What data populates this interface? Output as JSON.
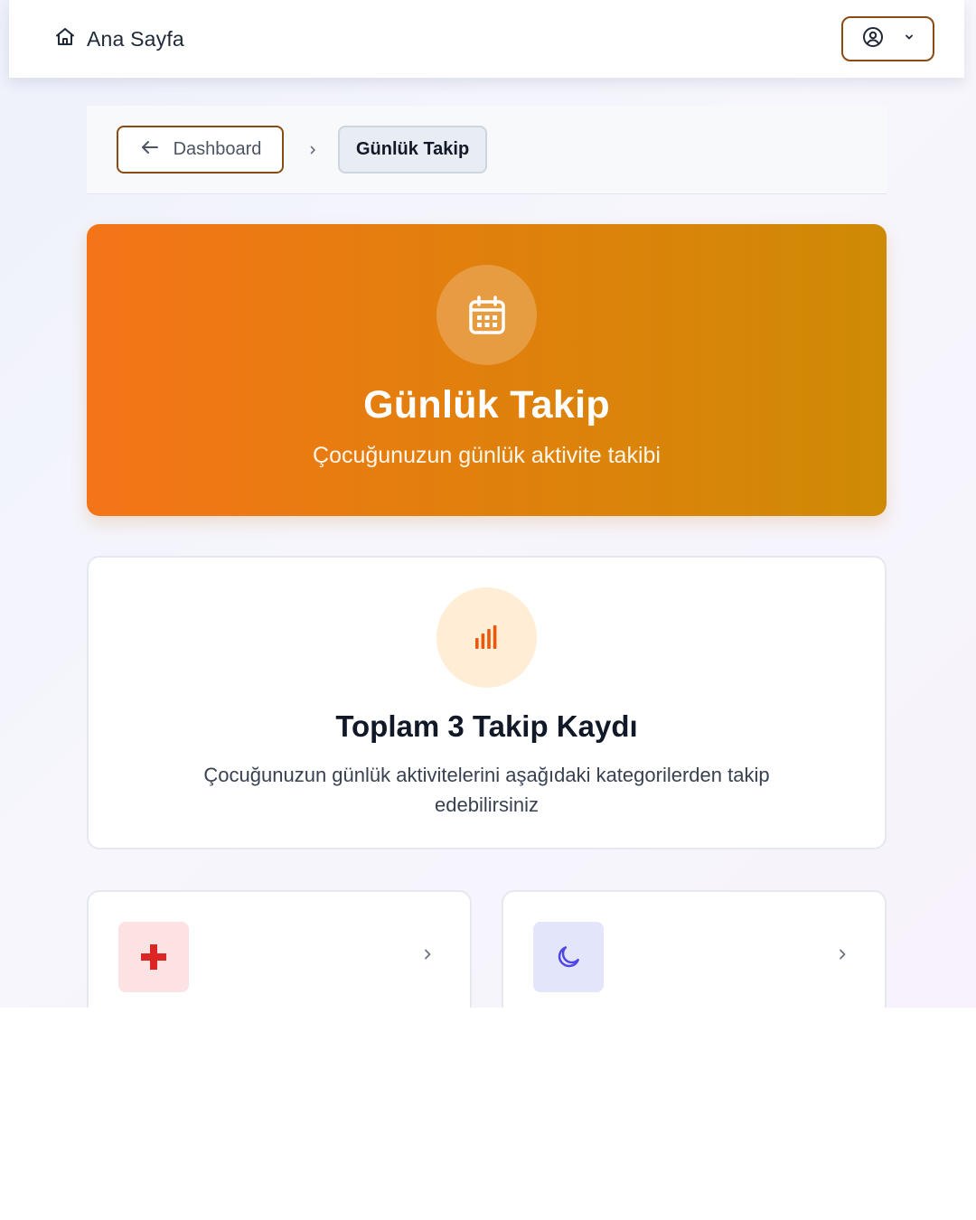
{
  "nav": {
    "home_label": "Ana Sayfa",
    "home_icon": "home-icon",
    "user_icon": "user-circle-icon",
    "user_menu_icon": "chevron-down-icon"
  },
  "breadcrumb": {
    "back_label": "Dashboard",
    "back_icon": "arrow-left-icon",
    "separator_icon": "chevron-right-icon",
    "current_label": "Günlük Takip"
  },
  "hero": {
    "icon": "calendar-icon",
    "title": "Günlük Takip",
    "subtitle": "Çocuğunuzun günlük aktivite takibi"
  },
  "summary": {
    "icon": "bar-chart-icon",
    "title": "Toplam 3 Takip Kaydı",
    "description": "Çocuğunuzun günlük aktivitelerini aşağıdaki kategorilerden takip edebilirsiniz"
  },
  "categories": [
    {
      "icon": "medical-cross-icon",
      "color": "#dc2626"
    },
    {
      "icon": "moon-icon",
      "color": "#4f46e5"
    }
  ],
  "colors": {
    "accent_border": "#8a4b12",
    "hero_gradient_start": "#f57418",
    "hero_gradient_end": "#cf8a05",
    "summary_icon": "#ea580c"
  }
}
